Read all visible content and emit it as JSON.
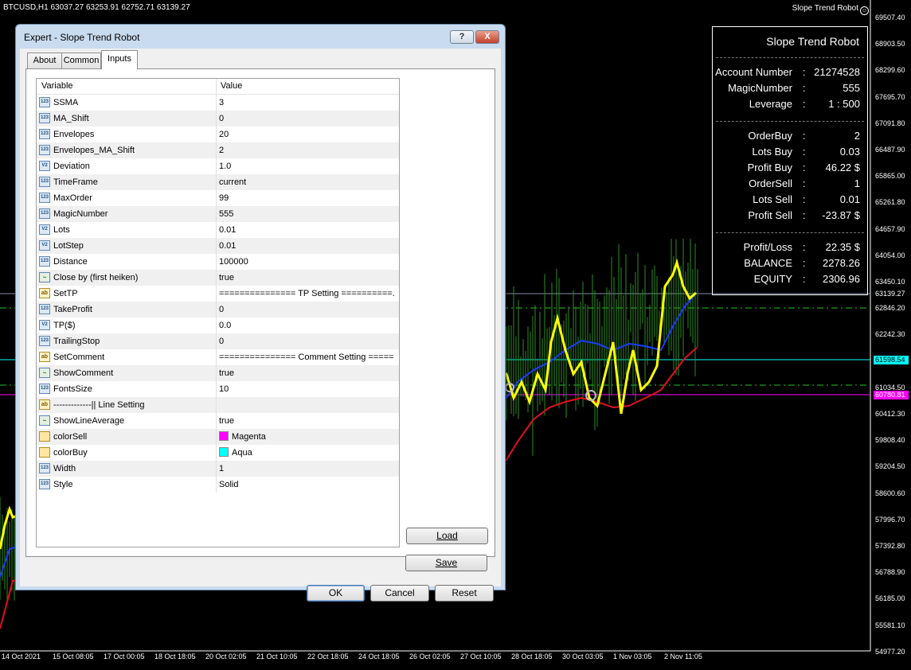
{
  "chart": {
    "header": "BTCUSD,H1  63037.27 63253.91 62752.71 63139.27",
    "ea_name": "Slope Trend Robot",
    "price_scale": [
      "69507.40",
      "68903.50",
      "68299.60",
      "67695.70",
      "67091.80",
      "66487.90",
      "65865.00",
      "65261.80",
      "64657.90",
      "64054.00",
      "63450.10",
      "62846.20",
      "62242.30",
      "61638.40",
      "61034.50",
      "60412.30",
      "59808.40",
      "59204.50",
      "58600.60",
      "57996.70",
      "57392.80",
      "56788.90",
      "56185.00",
      "55581.10",
      "54977.20"
    ],
    "time_scale": [
      "14 Oct 2021",
      "15 Oct 08:05",
      "17 Oct 00:05",
      "18 Oct 18:05",
      "20 Oct 02:05",
      "21 Oct 10:05",
      "22 Oct 18:05",
      "24 Oct 18:05",
      "26 Oct 02:05",
      "27 Oct 10:05",
      "28 Oct 18:05",
      "30 Oct 03:05",
      "1 Nov 03:05",
      "2 Nov 11:05"
    ],
    "price_badges": [
      {
        "text": "63139.27",
        "bg": "#000000",
        "fg": "#ffffff"
      },
      {
        "text": "61598.54",
        "bg": "#00ffff",
        "fg": "#000000"
      },
      {
        "text": "60780.81",
        "bg": "#ff00ff",
        "fg": "#ffffff"
      }
    ],
    "colors": {
      "price_line": "#2e8b22",
      "ma_fast": "#ffff00",
      "ma_blue": "#1a3cff",
      "ma_red": "#e0101c",
      "buy_line": "#00ffff",
      "sell_line": "#ff00ff"
    }
  },
  "info_panel": {
    "title": "Slope Trend Robot",
    "account": [
      {
        "label": "Account Number",
        "value": "21274528"
      },
      {
        "label": "MagicNumber",
        "value": "555"
      },
      {
        "label": "Leverage",
        "value": "1 : 500"
      }
    ],
    "orders": [
      {
        "label": "OrderBuy",
        "value": "2"
      },
      {
        "label": "Lots Buy",
        "value": "0.03"
      },
      {
        "label": "Profit Buy",
        "value": "46.22 $"
      },
      {
        "label": "OrderSell",
        "value": "1"
      },
      {
        "label": "Lots Sell",
        "value": "0.01"
      },
      {
        "label": "Profit Sell",
        "value": "-23.87 $"
      }
    ],
    "totals": [
      {
        "label": "Profit/Loss",
        "value": "22.35 $"
      },
      {
        "label": "BALANCE",
        "value": "2278.26"
      },
      {
        "label": "EQUITY",
        "value": "2306.96"
      }
    ],
    "colon": ":"
  },
  "dialog": {
    "title": "Expert - Slope Trend Robot",
    "help_label": "?",
    "close_label": "X",
    "tabs": [
      {
        "label": "About",
        "active": false
      },
      {
        "label": "Common",
        "active": false
      },
      {
        "label": "Inputs",
        "active": true
      }
    ],
    "columns": {
      "variable": "Variable",
      "value": "Value"
    },
    "rows": [
      {
        "name": "SSMA",
        "value": "3",
        "type": "int"
      },
      {
        "name": "MA_Shift",
        "value": "0",
        "type": "int"
      },
      {
        "name": "Envelopes",
        "value": "20",
        "type": "int"
      },
      {
        "name": "Envelopes_MA_Shift",
        "value": "2",
        "type": "int"
      },
      {
        "name": "Deviation",
        "value": "1.0",
        "type": "double"
      },
      {
        "name": "TimeFrame",
        "value": "current",
        "type": "int"
      },
      {
        "name": "MaxOrder",
        "value": "99",
        "type": "int"
      },
      {
        "name": "MagicNumber",
        "value": "555",
        "type": "int"
      },
      {
        "name": "Lots",
        "value": "0.01",
        "type": "double"
      },
      {
        "name": "LotStep",
        "value": "0.01",
        "type": "double"
      },
      {
        "name": "Distance",
        "value": "100000",
        "type": "int"
      },
      {
        "name": "Close by (first heiken)",
        "value": "true",
        "type": "bool"
      },
      {
        "name": "SetTP",
        "value": "=============== TP Setting ==========...",
        "type": "string"
      },
      {
        "name": "TakeProfit",
        "value": "0",
        "type": "int"
      },
      {
        "name": "TP($)",
        "value": "0.0",
        "type": "double"
      },
      {
        "name": "TrailingStop",
        "value": "0",
        "type": "int"
      },
      {
        "name": "SetComment",
        "value": "=============== Comment Setting =====...",
        "type": "string"
      },
      {
        "name": "ShowComment",
        "value": "true",
        "type": "bool"
      },
      {
        "name": "FontsSize",
        "value": "10",
        "type": "int"
      },
      {
        "name": "-------------|| Line Setting",
        "value": "",
        "type": "string"
      },
      {
        "name": "ShowLineAverage",
        "value": "true",
        "type": "bool"
      },
      {
        "name": "colorSell",
        "value": "Magenta",
        "type": "color",
        "swatch": "#ff00ff"
      },
      {
        "name": "colorBuy",
        "value": "Aqua",
        "type": "color",
        "swatch": "#00ffff"
      },
      {
        "name": "Width",
        "value": "1",
        "type": "int"
      },
      {
        "name": "Style",
        "value": "Solid",
        "type": "int"
      }
    ],
    "type_icons": {
      "int": "123",
      "double": "V2",
      "bool": "~",
      "string": "ab",
      "color": ""
    },
    "buttons": {
      "load": "Load",
      "save": "Save",
      "ok": "OK",
      "cancel": "Cancel",
      "reset": "Reset"
    }
  }
}
